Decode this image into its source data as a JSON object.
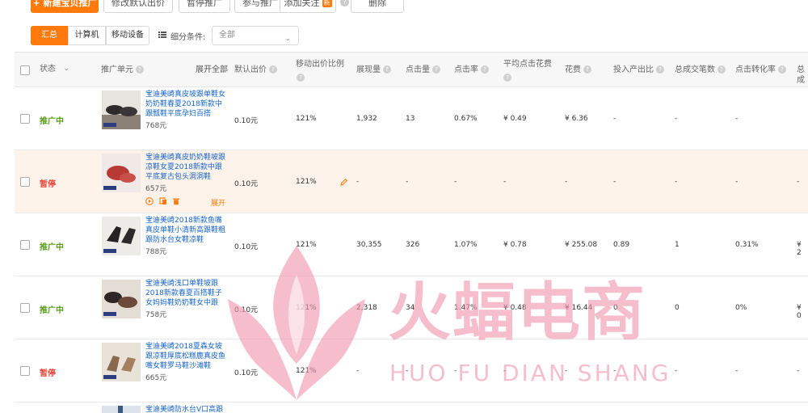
{
  "toolbar": {
    "new_plan_label": "+ 新建宝贝推广",
    "modify_bid_label": "修改默认出价",
    "pause_label": "暂停推广",
    "join_label": "参与推广",
    "add_follow_label": "添加关注",
    "new_badge": "新",
    "delete_label": "删除"
  },
  "filter": {
    "tabs": [
      "汇总",
      "计算机",
      "移动设备"
    ],
    "active_tab": "汇总",
    "condition_label": "细分条件:",
    "condition_value": "全部"
  },
  "table": {
    "headers": {
      "status": "状态",
      "unit": "推广单元",
      "expand_all": "展开全部",
      "default_bid": "默认出价",
      "mobile_bid_ratio": "移动出价比例",
      "impressions": "展现量",
      "clicks": "点击量",
      "ctr": "点击率",
      "avg_cpc": "平均点击花费",
      "cost": "花费",
      "roi": "投入产出比",
      "total_transactions": "总成交笔数",
      "click_conversion": "点击转化率",
      "last_partial": "总成"
    },
    "rows": [
      {
        "status": "推广中",
        "status_color": "#5a9e1c",
        "name": "宝迪美崎真皮坡跟单鞋女奶奶鞋春夏2018新款中跟瓢鞋平底孕妇百搭",
        "price": "768元",
        "default_bid": "0.10元",
        "mobile_ratio": "121%",
        "impressions": "1,932",
        "clicks": "13",
        "ctr": "0.67%",
        "avg_cpc": "¥ 0.49",
        "cost": "¥ 6.36",
        "roi": "-",
        "transactions": "-",
        "conversion": "-",
        "last": ""
      },
      {
        "status": "暂停",
        "status_color": "#e8453c",
        "name": "宝迪美崎真皮奶奶鞋坡跟凉鞋女夏2018新款中跟平底复古包头洞洞鞋",
        "price": "657元",
        "default_bid": "0.10元",
        "mobile_ratio": "121%",
        "impressions": "-",
        "clicks": "-",
        "ctr": "-",
        "avg_cpc": "-",
        "cost": "-",
        "roi": "-",
        "transactions": "-",
        "conversion": "-",
        "last": "-",
        "expand_label": "展开"
      },
      {
        "status": "推广中",
        "status_color": "#5a9e1c",
        "name": "宝迪美崎2018新款鱼嘴真皮单鞋小清新高跟鞋粗跟防水台女鞋凉鞋",
        "price": "788元",
        "default_bid": "0.10元",
        "mobile_ratio": "121%",
        "impressions": "30,355",
        "clicks": "326",
        "ctr": "1.07%",
        "avg_cpc": "¥ 0.78",
        "cost": "¥ 255.08",
        "roi": "0.89",
        "transactions": "1",
        "conversion": "0.31%",
        "last": "¥ 2"
      },
      {
        "status": "推广中",
        "status_color": "#5a9e1c",
        "name": "宝迪美崎浅口单鞋坡跟2018新款春夏百搭鞋子女妈妈鞋奶奶鞋女中跟",
        "price": "758元",
        "default_bid": "0.10元",
        "mobile_ratio": "121%",
        "impressions": "2,318",
        "clicks": "34",
        "ctr": "1.47%",
        "avg_cpc": "¥ 0.48",
        "cost": "¥ 16.44",
        "roi": "0",
        "transactions": "0",
        "conversion": "0%",
        "last": "¥ 0"
      },
      {
        "status": "暂停",
        "status_color": "#e8453c",
        "name": "宝迪美崎2018夏森女坡跟凉鞋厚底松糕鹿真皮鱼嘴女鞋罗马鞋沙滩鞋",
        "price": "665元",
        "default_bid": "0.10元",
        "mobile_ratio": "121%",
        "impressions": "-",
        "clicks": "-",
        "ctr": "-",
        "avg_cpc": "-",
        "cost": "-",
        "roi": "-",
        "transactions": "-",
        "conversion": "-",
        "last": "-"
      },
      {
        "status": "",
        "status_color": "#5a9e1c",
        "name": "宝迪美崎防水台V口高跟",
        "price": ""
      }
    ]
  },
  "watermark": {
    "title": "火蝠电商",
    "subtitle": "HUO FU DIAN SHANG",
    "color": "#f096af"
  }
}
